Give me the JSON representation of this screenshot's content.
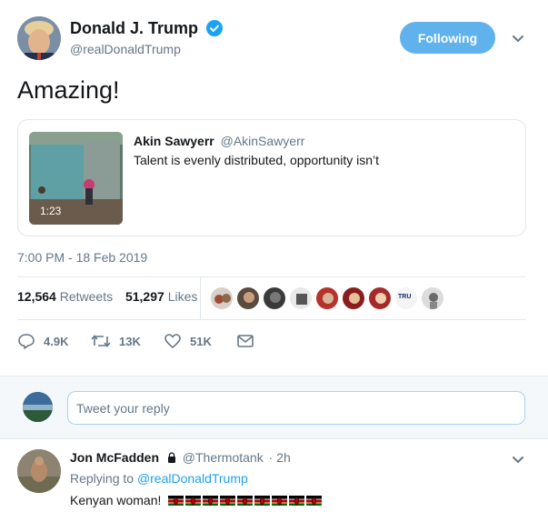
{
  "author": {
    "name": "Donald J. Trump",
    "handle": "@realDonaldTrump",
    "follow_label": "Following"
  },
  "tweet": {
    "text": "Amazing!",
    "timestamp": "7:00 PM - 18 Feb 2019"
  },
  "quoted": {
    "name": "Akin Sawyerr",
    "handle": "@AkinSawyerr",
    "text": "Talent is evenly distributed, opportunity isn’t",
    "video_duration": "1:23"
  },
  "stats": {
    "retweets_count": "12,564",
    "retweets_label": "Retweets",
    "likes_count": "51,297",
    "likes_label": "Likes",
    "liker_badge": "TRU"
  },
  "actions": {
    "reply_count": "4.9K",
    "retweet_count": "13K",
    "like_count": "51K"
  },
  "reply_box": {
    "placeholder": "Tweet your reply"
  },
  "reply": {
    "name": "Jon McFadden",
    "handle": "@Thermotank",
    "time": "· 2h",
    "replying_prefix": "Replying to",
    "replying_to": "@realDonaldTrump",
    "text": "Kenyan woman!",
    "flag_count": 9
  },
  "colors": {
    "accent": "#1da1f2",
    "follow_button": "#5fb2ec",
    "muted": "#657786",
    "border": "#e1e8ed"
  },
  "icons": {
    "verified": "verified-badge-icon",
    "caret": "chevron-down-icon",
    "reply": "reply-icon",
    "retweet": "retweet-icon",
    "like": "heart-icon",
    "dm": "envelope-icon",
    "lock": "lock-icon",
    "flag": "kenya-flag-icon"
  }
}
